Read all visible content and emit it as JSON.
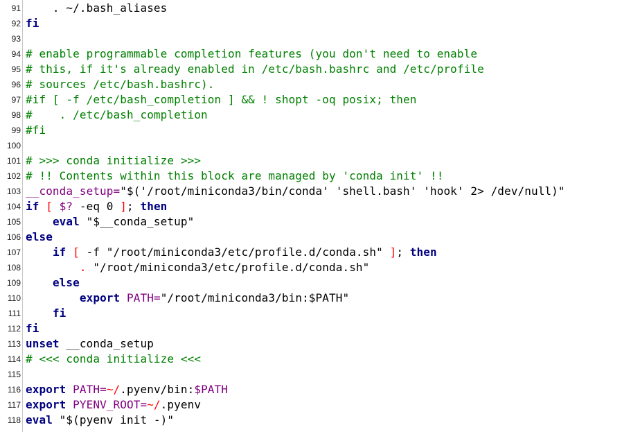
{
  "editor": {
    "lines": [
      {
        "num": "91",
        "tokens": [
          {
            "t": "    . ~/.bash_aliases",
            "c": "st"
          }
        ]
      },
      {
        "num": "92",
        "tokens": [
          {
            "t": "fi",
            "c": "kw"
          }
        ]
      },
      {
        "num": "93",
        "tokens": []
      },
      {
        "num": "94",
        "tokens": [
          {
            "t": "# enable programmable completion features (you don't need to enable",
            "c": "cm"
          }
        ]
      },
      {
        "num": "95",
        "tokens": [
          {
            "t": "# this, if it's already enabled in /etc/bash.bashrc and /etc/profile",
            "c": "cm"
          }
        ]
      },
      {
        "num": "96",
        "tokens": [
          {
            "t": "# sources /etc/bash.bashrc).",
            "c": "cm"
          }
        ]
      },
      {
        "num": "97",
        "tokens": [
          {
            "t": "#if [ -f /etc/bash_completion ] && ! shopt -oq posix; then",
            "c": "cm"
          }
        ]
      },
      {
        "num": "98",
        "tokens": [
          {
            "t": "#    . /etc/bash_completion",
            "c": "cm"
          }
        ]
      },
      {
        "num": "99",
        "tokens": [
          {
            "t": "#fi",
            "c": "cm"
          }
        ]
      },
      {
        "num": "100",
        "tokens": []
      },
      {
        "num": "101",
        "tokens": [
          {
            "t": "# >>> conda initialize >>>",
            "c": "cm"
          }
        ]
      },
      {
        "num": "102",
        "tokens": [
          {
            "t": "# !! Contents within this block are managed by 'conda init' !!",
            "c": "cm"
          }
        ]
      },
      {
        "num": "103",
        "tokens": [
          {
            "t": "__conda_setup=",
            "c": "var"
          },
          {
            "t": "\"$('/root/miniconda3/bin/conda' 'shell.bash' 'hook' 2> /dev/null)\"",
            "c": "st"
          }
        ]
      },
      {
        "num": "104",
        "tokens": [
          {
            "t": "if",
            "c": "kw"
          },
          {
            "t": " [ ",
            "c": "op"
          },
          {
            "t": "$?",
            "c": "var"
          },
          {
            "t": " -eq 0 ",
            "c": "st"
          },
          {
            "t": "]",
            "c": "op"
          },
          {
            "t": "; ",
            "c": "st"
          },
          {
            "t": "then",
            "c": "kw"
          }
        ]
      },
      {
        "num": "105",
        "tokens": [
          {
            "t": "    ",
            "c": "st"
          },
          {
            "t": "eval",
            "c": "kw"
          },
          {
            "t": " \"$__conda_setup\"",
            "c": "st"
          }
        ]
      },
      {
        "num": "106",
        "tokens": [
          {
            "t": "else",
            "c": "kw"
          }
        ]
      },
      {
        "num": "107",
        "tokens": [
          {
            "t": "    ",
            "c": "st"
          },
          {
            "t": "if",
            "c": "kw"
          },
          {
            "t": " [ ",
            "c": "op"
          },
          {
            "t": "-f \"/root/miniconda3/etc/profile.d/conda.sh\" ",
            "c": "st"
          },
          {
            "t": "]",
            "c": "op"
          },
          {
            "t": "; ",
            "c": "st"
          },
          {
            "t": "then",
            "c": "kw"
          }
        ]
      },
      {
        "num": "108",
        "tokens": [
          {
            "t": "        ",
            "c": "st"
          },
          {
            "t": ".",
            "c": "op"
          },
          {
            "t": " \"/root/miniconda3/etc/profile.d/conda.sh\"",
            "c": "st"
          }
        ]
      },
      {
        "num": "109",
        "tokens": [
          {
            "t": "    ",
            "c": "st"
          },
          {
            "t": "else",
            "c": "kw"
          }
        ]
      },
      {
        "num": "110",
        "tokens": [
          {
            "t": "        ",
            "c": "st"
          },
          {
            "t": "export",
            "c": "kw"
          },
          {
            "t": " ",
            "c": "st"
          },
          {
            "t": "PATH=",
            "c": "var"
          },
          {
            "t": "\"/root/miniconda3/bin:$PATH\"",
            "c": "st"
          }
        ]
      },
      {
        "num": "111",
        "tokens": [
          {
            "t": "    ",
            "c": "st"
          },
          {
            "t": "fi",
            "c": "kw"
          }
        ]
      },
      {
        "num": "112",
        "tokens": [
          {
            "t": "fi",
            "c": "kw"
          }
        ]
      },
      {
        "num": "113",
        "tokens": [
          {
            "t": "unset",
            "c": "kw"
          },
          {
            "t": " __conda_setup",
            "c": "st"
          }
        ]
      },
      {
        "num": "114",
        "tokens": [
          {
            "t": "# <<< conda initialize <<<",
            "c": "cm"
          }
        ]
      },
      {
        "num": "115",
        "tokens": []
      },
      {
        "num": "116",
        "tokens": [
          {
            "t": "export",
            "c": "kw"
          },
          {
            "t": " ",
            "c": "st"
          },
          {
            "t": "PATH=",
            "c": "var"
          },
          {
            "t": "~/",
            "c": "op"
          },
          {
            "t": ".pyenv/bin:",
            "c": "st"
          },
          {
            "t": "$PATH",
            "c": "var"
          }
        ]
      },
      {
        "num": "117",
        "tokens": [
          {
            "t": "export",
            "c": "kw"
          },
          {
            "t": " ",
            "c": "st"
          },
          {
            "t": "PYENV_ROOT=",
            "c": "var"
          },
          {
            "t": "~/",
            "c": "op"
          },
          {
            "t": ".pyenv",
            "c": "st"
          }
        ]
      },
      {
        "num": "118",
        "tokens": [
          {
            "t": "eval",
            "c": "kw"
          },
          {
            "t": " \"$(pyenv init -)\"",
            "c": "st"
          }
        ]
      }
    ]
  },
  "colors": {
    "keyword": "#000080",
    "comment": "#008000",
    "variable": "#800080",
    "operator": "#ff0000",
    "text": "#000000"
  }
}
